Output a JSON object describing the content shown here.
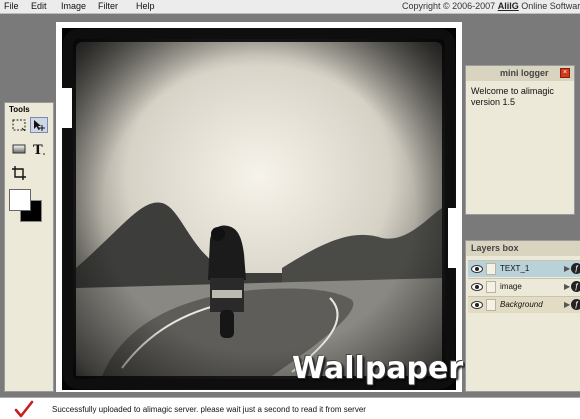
{
  "menu": {
    "items": [
      "File",
      "Edit",
      "Image",
      "Filter",
      "Help"
    ],
    "copyright_prefix": "Copyright © 2006-2007",
    "copyright_brand": "AlilG",
    "copyright_suffix": "Online Software. A"
  },
  "tools": {
    "title": "Tools",
    "items": [
      {
        "name": "marquee-select-icon",
        "active": false
      },
      {
        "name": "move-tool-icon",
        "active": true
      },
      {
        "name": "gradient-rect-icon",
        "active": false
      },
      {
        "name": "text-tool-icon",
        "active": false
      },
      {
        "name": "crop-tool-icon",
        "active": false
      }
    ],
    "foreground_color": "#ffffff",
    "background_color": "#000000"
  },
  "canvas": {
    "overlay_text": "Wallpaper"
  },
  "logger": {
    "title": "mini logger",
    "close_label": "×",
    "message": "Welcome to alimagic version 1.5"
  },
  "layers": {
    "title": "Layers box",
    "rows": [
      {
        "name": "TEXT_1",
        "state": "selected"
      },
      {
        "name": "image",
        "state": "normal"
      },
      {
        "name": "Background",
        "state": "background"
      }
    ]
  },
  "status": {
    "message": "Successfully uploaded to alimagic server. please wait just a second to read it from server"
  },
  "colors": {
    "panel": "#ece9d8",
    "selected_layer": "#b9d1d9",
    "workspace": "#7a7a7a",
    "status_check": "#c81e1e"
  }
}
